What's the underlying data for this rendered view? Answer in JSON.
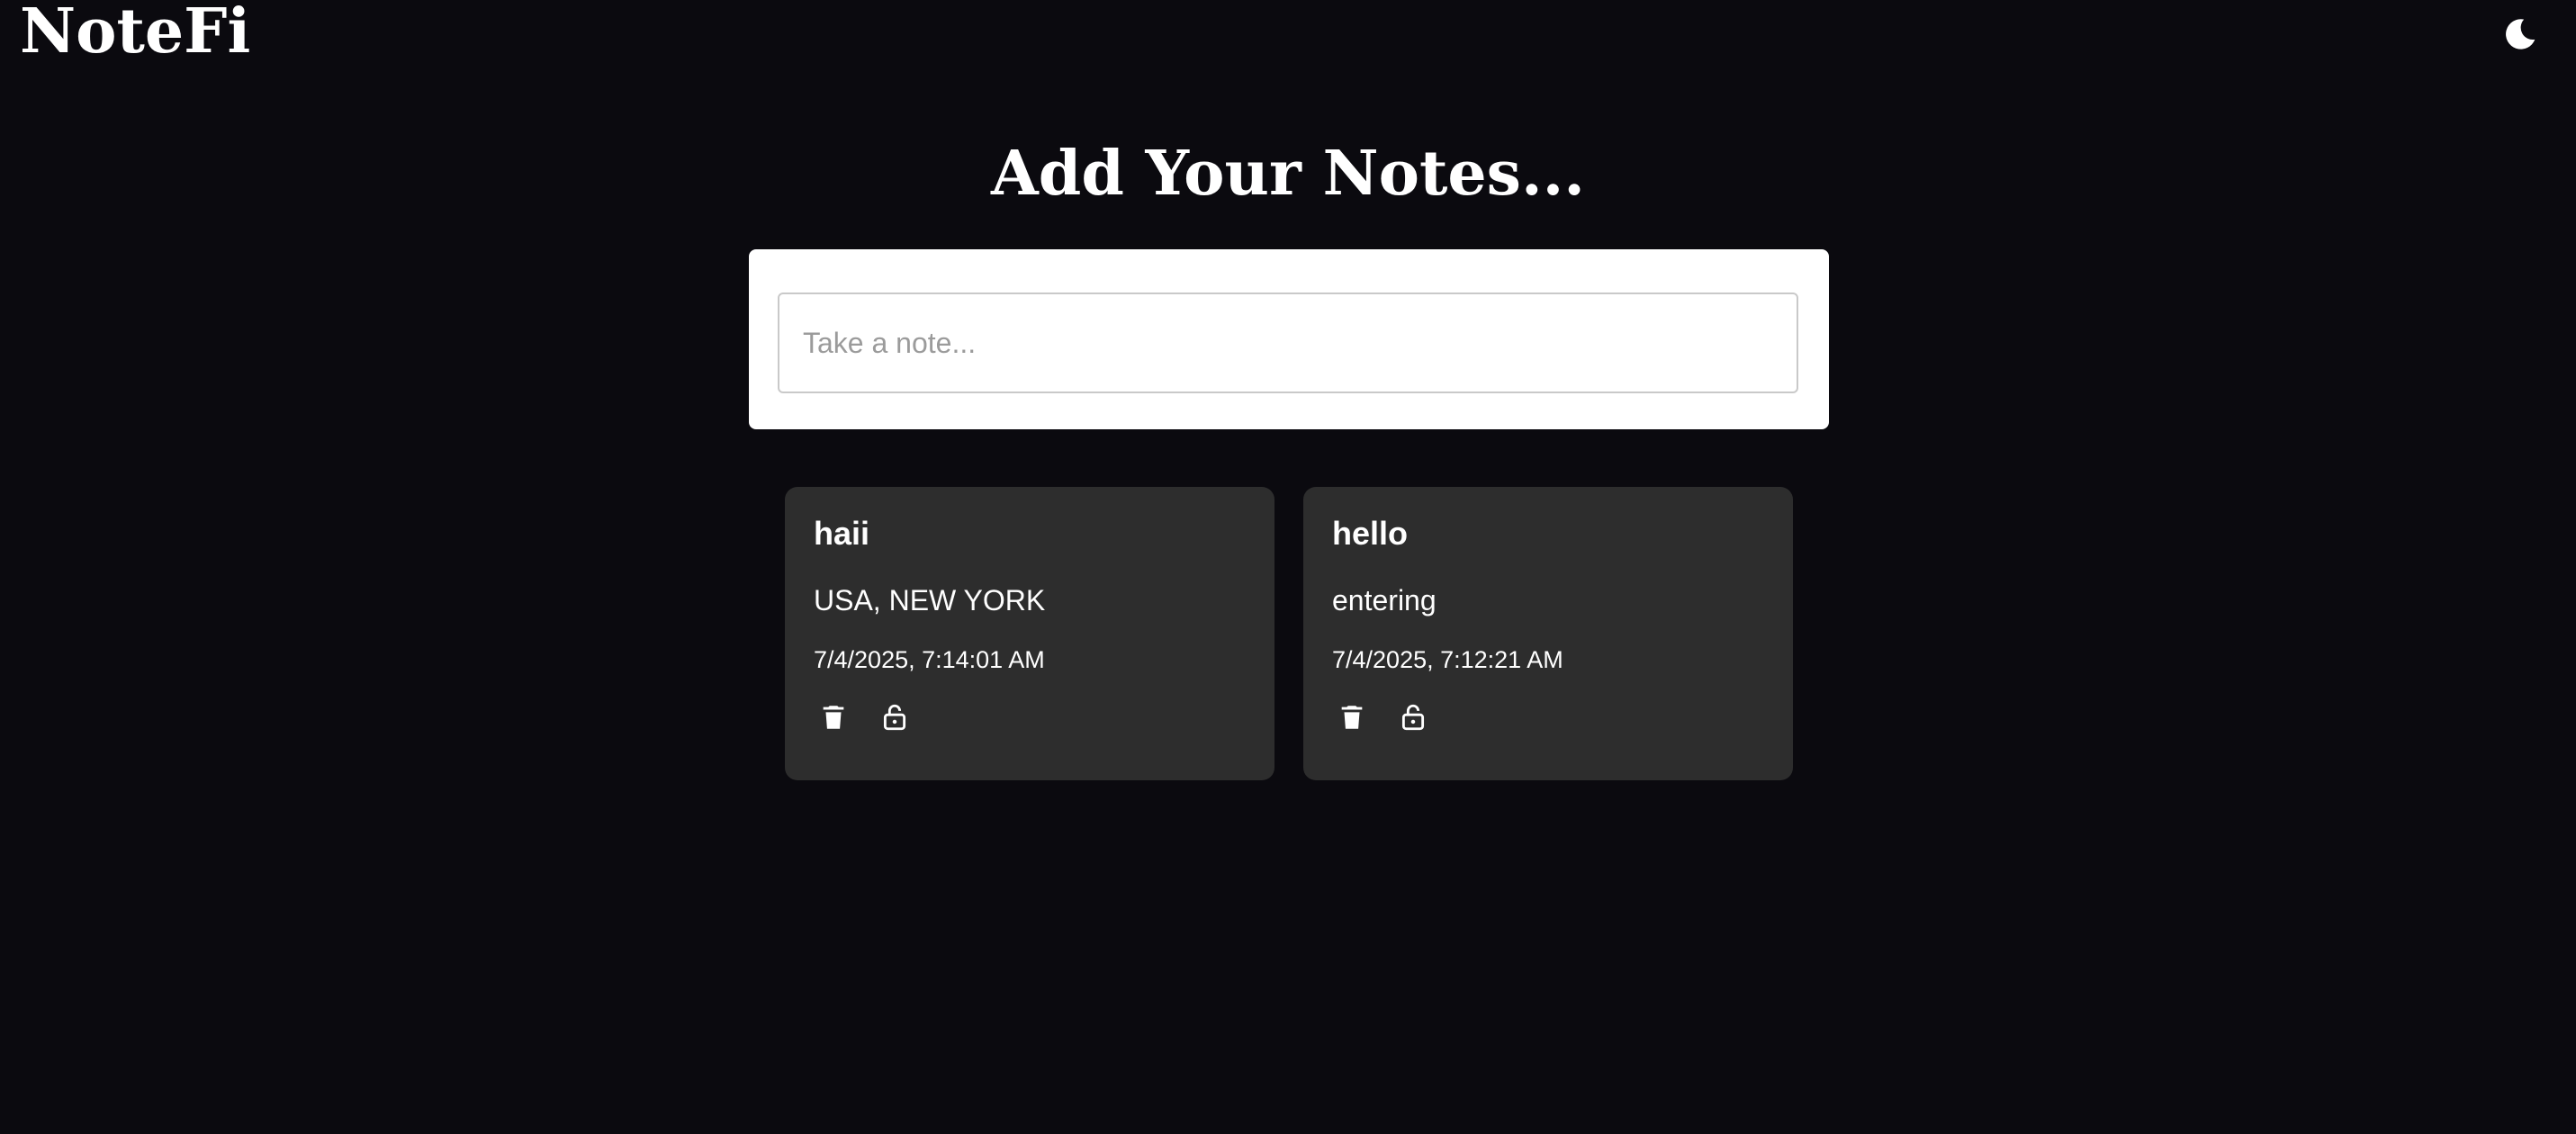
{
  "header": {
    "brand": "NoteFi",
    "theme_toggle_icon": "moon-icon"
  },
  "main": {
    "title": "Add Your Notes...",
    "composer": {
      "placeholder": "Take a note...",
      "value": ""
    }
  },
  "notes": [
    {
      "title": "haii",
      "body": "USA, NEW YORK",
      "date": "7/4/2025, 7:14:01 AM",
      "actions": [
        "trash-icon",
        "unlock-icon"
      ]
    },
    {
      "title": "hello",
      "body": "entering",
      "date": "7/4/2025, 7:12:21 AM",
      "actions": [
        "trash-icon",
        "unlock-icon"
      ]
    }
  ],
  "colors": {
    "background": "#0b0a0f",
    "card": "#2d2d2d",
    "composer": "#ffffff",
    "text": "#ffffff"
  }
}
